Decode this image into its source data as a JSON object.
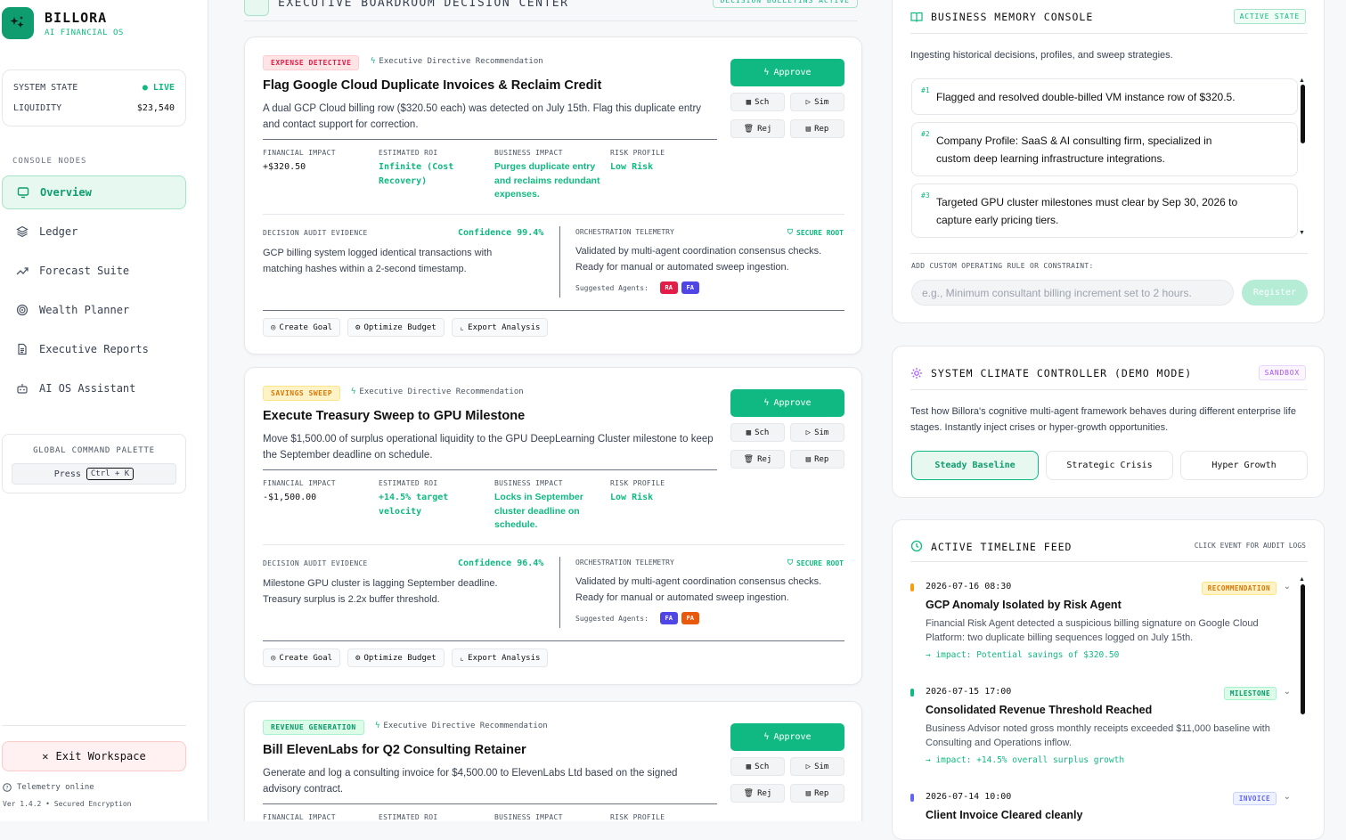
{
  "brand": {
    "name": "BILLORA",
    "sub": "AI FINANCIAL OS"
  },
  "system": {
    "state_label": "SYSTEM STATE",
    "state_value": "LIVE",
    "liquidity_label": "LIQUIDITY",
    "liquidity_value": "$23,540"
  },
  "nav": {
    "header": "CONSOLE NODES",
    "items": [
      {
        "label": "Overview",
        "icon": "monitor-icon"
      },
      {
        "label": "Ledger",
        "icon": "layers-icon"
      },
      {
        "label": "Forecast Suite",
        "icon": "trend-icon"
      },
      {
        "label": "Wealth Planner",
        "icon": "target-icon"
      },
      {
        "label": "Executive Reports",
        "icon": "file-icon"
      },
      {
        "label": "AI OS Assistant",
        "icon": "bot-icon"
      }
    ]
  },
  "command": {
    "title": "GLOBAL COMMAND PALETTE",
    "press": "Press",
    "shortcut": "Ctrl + K"
  },
  "exit_label": "Exit Workspace",
  "footer": {
    "telemetry": "Telemetry online",
    "version": "Ver 1.4.2 • Secured Encryption"
  },
  "main": {
    "title": "EXECUTIVE BOARDROOM DECISION CENTER",
    "badge": "DECISION BULLETINS ACTIVE"
  },
  "labels": {
    "rec": "Executive Directive Recommendation",
    "fin": "FINANCIAL IMPACT",
    "roi": "ESTIMATED ROI",
    "biz": "BUSINESS IMPACT",
    "risk": "RISK PROFILE",
    "audit": "DECISION AUDIT EVIDENCE",
    "orch": "ORCHESTRATION TELEMETRY",
    "secure": "SECURE ROOT",
    "agents": "Suggested Agents:",
    "approve": "Approve",
    "sch": "Sch",
    "sim": "Sim",
    "rej": "Rej",
    "rep": "Rep",
    "goal": "Create Goal",
    "budget": "Optimize Budget",
    "export": "Export Analysis"
  },
  "cards": [
    {
      "tag": "EXPENSE DETECTIVE",
      "title": "Flag Google Cloud Duplicate Invoices & Reclaim Credit",
      "desc": "A dual GCP Cloud billing row ($320.50 each) was detected on July 15th. Flag this duplicate entry and contact support for correction.",
      "fin": "+$320.50",
      "roi": "Infinite (Cost Recovery)",
      "biz": "Purges duplicate entry and reclaims redundant expenses.",
      "risk": "Low Risk",
      "confidence": "Confidence 99.4%",
      "audit": "GCP billing system logged identical transactions with matching hashes within a 2-second timestamp.",
      "orch": "Validated by multi-agent coordination consensus checks. Ready for manual or automated sweep ingestion.",
      "agents": [
        "RA",
        "FA"
      ]
    },
    {
      "tag": "SAVINGS SWEEP",
      "title": "Execute Treasury Sweep to GPU Milestone",
      "desc": "Move $1,500.00 of surplus operational liquidity to the GPU DeepLearning Cluster milestone to keep the September deadline on schedule.",
      "fin": "-$1,500.00",
      "roi": "+14.5% target velocity",
      "biz": "Locks in September cluster deadline on schedule.",
      "risk": "Low Risk",
      "confidence": "Confidence 96.4%",
      "audit": "Milestone GPU cluster is lagging September deadline. Treasury surplus is 2.2x buffer threshold.",
      "orch": "Validated by multi-agent coordination consensus checks. Ready for manual or automated sweep ingestion.",
      "agents": [
        "FA",
        "PA"
      ]
    },
    {
      "tag": "REVENUE GENERATION",
      "title": "Bill ElevenLabs for Q2 Consulting Retainer",
      "desc": "Generate and log a consulting invoice for $4,500.00 to ElevenLabs Ltd based on the signed advisory contract."
    }
  ],
  "memory": {
    "title": "BUSINESS MEMORY CONSOLE",
    "badge": "ACTIVE STATE",
    "intro": "Ingesting historical decisions, profiles, and sweep strategies.",
    "items": [
      {
        "n": "#1",
        "text": "Flagged and resolved double-billed VM instance row of $320.5."
      },
      {
        "n": "#2",
        "text": "Company Profile: SaaS & AI consulting firm, specialized in custom deep learning infrastructure integrations."
      },
      {
        "n": "#3",
        "text": "Targeted GPU cluster milestones must clear by Sep 30, 2026 to capture early pricing tiers."
      }
    ],
    "rule_label": "ADD CUSTOM OPERATING RULE OR CONSTRAINT:",
    "placeholder": "e.g., Minimum consultant billing increment set to 2 hours.",
    "register": "Register"
  },
  "climate": {
    "title": "SYSTEM CLIMATE CONTROLLER (DEMO MODE)",
    "badge": "SANDBOX",
    "desc": "Test how Billora's cognitive multi-agent framework behaves during different enterprise life stages. Instantly inject crises or hyper-growth opportunities.",
    "modes": [
      "Steady Baseline",
      "Strategic Crisis",
      "Hyper Growth"
    ]
  },
  "timeline": {
    "title": "ACTIVE TIMELINE FEED",
    "hint": "CLICK EVENT FOR AUDIT LOGS",
    "events": [
      {
        "date": "2026-07-16 08:30",
        "badge": "RECOMMENDATION",
        "title": "GCP Anomaly Isolated by Risk Agent",
        "desc": "Financial Risk Agent detected a suspicious billing signature on Google Cloud Platform: two duplicate billing sequences logged on July 15th.",
        "impact": "→ impact: Potential savings of $320.50"
      },
      {
        "date": "2026-07-15 17:00",
        "badge": "MILESTONE",
        "title": "Consolidated Revenue Threshold Reached",
        "desc": "Business Advisor noted gross monthly receipts exceeded $11,000 baseline with Consulting and Operations inflow.",
        "impact": "→ impact: +14.5% overall surplus growth"
      },
      {
        "date": "2026-07-14 10:00",
        "badge": "INVOICE",
        "title": "Client Invoice Cleared cleanly"
      }
    ]
  },
  "colors": {
    "accent": "#10b981",
    "expense": "#e11d48",
    "savings": "#d97706",
    "revenue": "#059669",
    "invoice": "#6366f1"
  }
}
